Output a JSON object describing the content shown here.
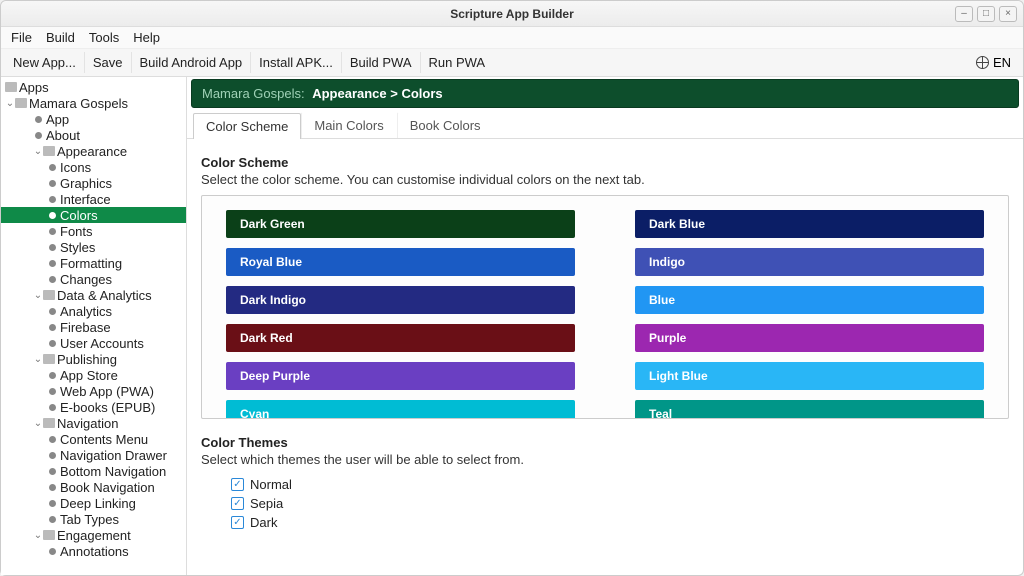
{
  "window": {
    "title": "Scripture App Builder"
  },
  "menu": [
    "File",
    "Build",
    "Tools",
    "Help"
  ],
  "toolbar": [
    "New App...",
    "Save",
    "Build Android App",
    "Install APK...",
    "Build PWA",
    "Run PWA"
  ],
  "language": "EN",
  "tree": {
    "root": "Apps",
    "app": "Mamara Gospels",
    "items": [
      {
        "l": 2,
        "kind": "leaf",
        "label": "App"
      },
      {
        "l": 2,
        "kind": "leaf",
        "label": "About"
      },
      {
        "l": 2,
        "kind": "folder",
        "label": "Appearance",
        "open": true
      },
      {
        "l": 3,
        "kind": "leaf",
        "label": "Icons"
      },
      {
        "l": 3,
        "kind": "leaf",
        "label": "Graphics"
      },
      {
        "l": 3,
        "kind": "leaf",
        "label": "Interface"
      },
      {
        "l": 3,
        "kind": "leaf",
        "label": "Colors",
        "selected": true
      },
      {
        "l": 3,
        "kind": "leaf",
        "label": "Fonts"
      },
      {
        "l": 3,
        "kind": "leaf",
        "label": "Styles"
      },
      {
        "l": 3,
        "kind": "leaf",
        "label": "Formatting"
      },
      {
        "l": 3,
        "kind": "leaf",
        "label": "Changes"
      },
      {
        "l": 2,
        "kind": "folder",
        "label": "Data & Analytics",
        "open": true
      },
      {
        "l": 3,
        "kind": "leaf",
        "label": "Analytics"
      },
      {
        "l": 3,
        "kind": "leaf",
        "label": "Firebase"
      },
      {
        "l": 3,
        "kind": "leaf",
        "label": "User Accounts"
      },
      {
        "l": 2,
        "kind": "folder",
        "label": "Publishing",
        "open": true
      },
      {
        "l": 3,
        "kind": "leaf",
        "label": "App Store"
      },
      {
        "l": 3,
        "kind": "leaf",
        "label": "Web App (PWA)"
      },
      {
        "l": 3,
        "kind": "leaf",
        "label": "E-books (EPUB)"
      },
      {
        "l": 2,
        "kind": "folder",
        "label": "Navigation",
        "open": true
      },
      {
        "l": 3,
        "kind": "leaf",
        "label": "Contents Menu"
      },
      {
        "l": 3,
        "kind": "leaf",
        "label": "Navigation Drawer"
      },
      {
        "l": 3,
        "kind": "leaf",
        "label": "Bottom Navigation"
      },
      {
        "l": 3,
        "kind": "leaf",
        "label": "Book Navigation"
      },
      {
        "l": 3,
        "kind": "leaf",
        "label": "Deep Linking"
      },
      {
        "l": 3,
        "kind": "leaf",
        "label": "Tab Types"
      },
      {
        "l": 2,
        "kind": "folder",
        "label": "Engagement",
        "open": true
      },
      {
        "l": 3,
        "kind": "leaf",
        "label": "Annotations"
      }
    ]
  },
  "breadcrumb": {
    "app": "Mamara Gospels:",
    "path": "Appearance > Colors"
  },
  "tabs": [
    "Color Scheme",
    "Main Colors",
    "Book Colors"
  ],
  "active_tab": 0,
  "scheme": {
    "title": "Color Scheme",
    "desc": "Select the color scheme. You can customise individual colors on the next tab.",
    "left": [
      {
        "label": "Dark Green",
        "color": "#0b4018"
      },
      {
        "label": "Royal Blue",
        "color": "#1a5bc4"
      },
      {
        "label": "Dark Indigo",
        "color": "#232a82"
      },
      {
        "label": "Dark Red",
        "color": "#6a0f16",
        "selected": true
      },
      {
        "label": "Deep Purple",
        "color": "#6a3fc2"
      },
      {
        "label": "Cyan",
        "color": "#00bcd4"
      }
    ],
    "right": [
      {
        "label": "Dark Blue",
        "color": "#0b1e66"
      },
      {
        "label": "Indigo",
        "color": "#3f51b5"
      },
      {
        "label": "Blue",
        "color": "#2196f3"
      },
      {
        "label": "Purple",
        "color": "#9c27b0"
      },
      {
        "label": "Light Blue",
        "color": "#29b6f6"
      },
      {
        "label": "Teal",
        "color": "#009688"
      }
    ]
  },
  "themes": {
    "title": "Color Themes",
    "desc": "Select which themes the user will be able to select from.",
    "options": [
      "Normal",
      "Sepia",
      "Dark"
    ]
  }
}
